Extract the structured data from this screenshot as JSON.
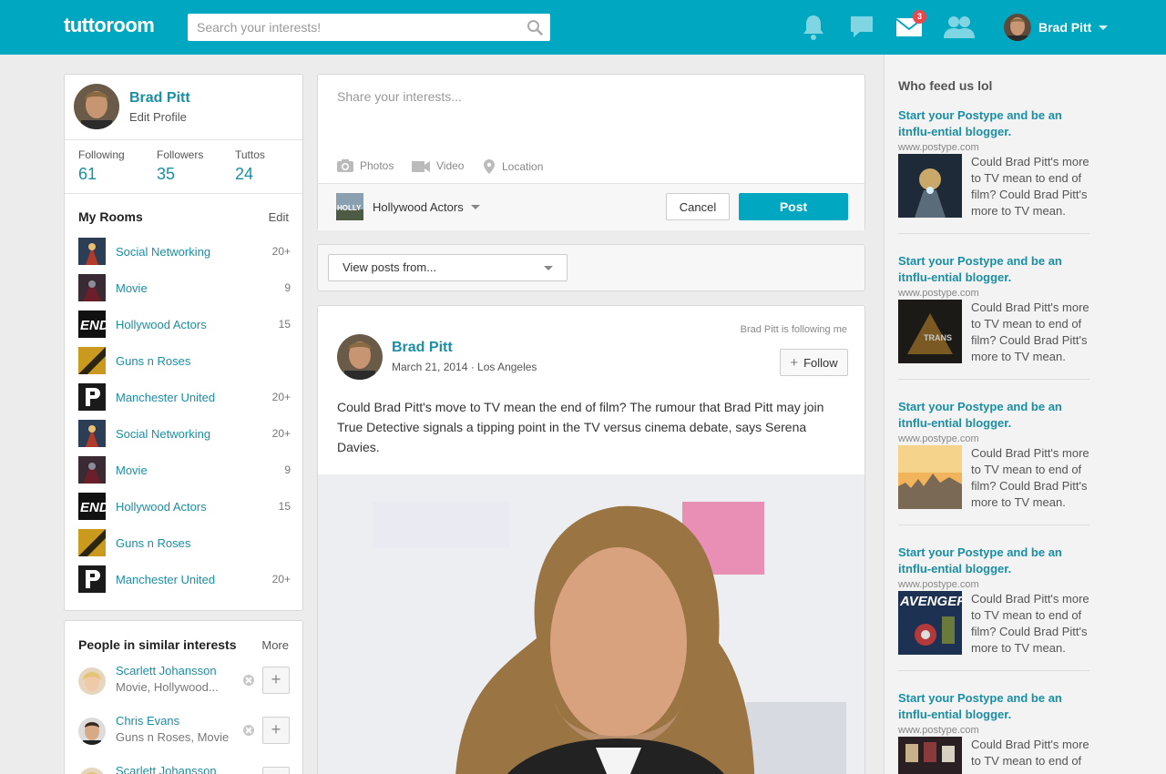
{
  "header": {
    "logo": "tuttoroom",
    "search_placeholder": "Search your interests!",
    "mail_badge": "3",
    "user_name": "Brad Pitt"
  },
  "profile": {
    "name": "Brad Pitt",
    "edit_label": "Edit Profile",
    "stats": [
      {
        "label": "Following",
        "value": "61"
      },
      {
        "label": "Followers",
        "value": "35"
      },
      {
        "label": "Tuttos",
        "value": "24"
      }
    ]
  },
  "rooms": {
    "title": "My Rooms",
    "action": "Edit",
    "items": [
      {
        "name": "Social Networking",
        "count": "20+"
      },
      {
        "name": "Movie",
        "count": "9"
      },
      {
        "name": "Hollywood Actors",
        "count": "15"
      },
      {
        "name": "Guns n Roses",
        "count": ""
      },
      {
        "name": "Manchester United",
        "count": "20+"
      },
      {
        "name": "Social Networking",
        "count": "20+"
      },
      {
        "name": "Movie",
        "count": "9"
      },
      {
        "name": "Hollywood Actors",
        "count": "15"
      },
      {
        "name": "Guns n Roses",
        "count": ""
      },
      {
        "name": "Manchester United",
        "count": "20+"
      }
    ]
  },
  "people": {
    "title": "People in similar interests",
    "action": "More",
    "items": [
      {
        "name": "Scarlett Johansson",
        "sub": "Movie, Hollywood..."
      },
      {
        "name": "Chris Evans",
        "sub": "Guns n Roses, Movie"
      },
      {
        "name": "Scarlett Johansson",
        "sub": ""
      }
    ]
  },
  "composer": {
    "placeholder": "Share your interests...",
    "attachments": [
      "Photos",
      "Video",
      "Location"
    ],
    "room": "Hollywood Actors",
    "cancel_label": "Cancel",
    "post_label": "Post"
  },
  "filter": {
    "label": "View posts from..."
  },
  "post": {
    "following_note": "Brad Pitt is following me",
    "author": "Brad Pitt",
    "meta": "March 21, 2014 · Los Angeles",
    "follow_label": "Follow",
    "body": "Could Brad Pitt's move to TV mean the end of film? The rumour that Brad Pitt may join True Detective signals a tipping point in the TV versus cinema debate, says Serena Davies."
  },
  "sidebar": {
    "title": "Who feed us lol",
    "items": [
      {
        "title": "Start your Postype and be an itnflu-ential blogger.",
        "url": "www.postype.com",
        "desc": "Could Brad Pitt's more to TV mean to end of film? Could Brad Pitt's more to TV mean."
      },
      {
        "title": "Start your Postype and be an itnflu-ential blogger.",
        "url": "www.postype.com",
        "desc": "Could Brad Pitt's more to TV mean to end of film? Could Brad Pitt's more to TV mean."
      },
      {
        "title": "Start your Postype and be an itnflu-ential blogger.",
        "url": "www.postype.com",
        "desc": "Could Brad Pitt's more to TV mean to end of film? Could Brad Pitt's more to TV mean."
      },
      {
        "title": "Start your Postype and be an itnflu-ential blogger.",
        "url": "www.postype.com",
        "desc": "Could Brad Pitt's more to TV mean to end of film? Could Brad Pitt's more to TV mean."
      },
      {
        "title": "Start your Postype and be an itnflu-ential blogger.",
        "url": "www.postype.com",
        "desc": "Could Brad Pitt's more to TV mean to end of"
      }
    ]
  },
  "colors": {
    "brand": "#00a7c0",
    "link": "#1a8ea3",
    "badge": "#e9474c"
  }
}
